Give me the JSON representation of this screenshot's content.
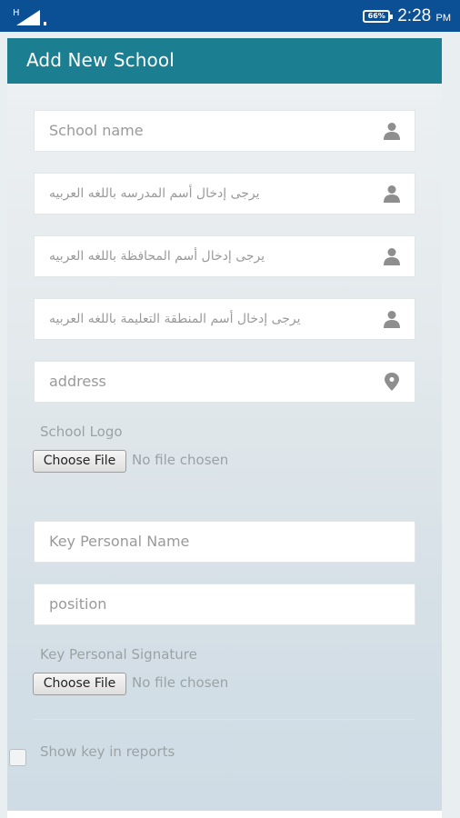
{
  "status_bar": {
    "network_type": "H",
    "battery_percent": "66%",
    "time": "2:28",
    "ampm": "PM"
  },
  "form": {
    "title": "Add New School",
    "fields": [
      {
        "placeholder": "School name",
        "icon": "person-icon"
      },
      {
        "placeholder": "يرجى إدخال أسم المدرسه باللغه العربيه",
        "icon": "person-icon"
      },
      {
        "placeholder": "يرجى إدخال أسم المحافظة باللغه العربيه",
        "icon": "person-icon"
      },
      {
        "placeholder": "يرجى إدخال أسم المنطقة التعليمة باللغه العربيه",
        "icon": "person-icon"
      },
      {
        "placeholder": "address",
        "icon": "map-pin-icon"
      }
    ],
    "school_logo": {
      "label": "School Logo",
      "button": "Choose File",
      "status": "No file chosen"
    },
    "key_personal_name": {
      "placeholder": "Key Personal Name"
    },
    "position": {
      "placeholder": "position"
    },
    "signature": {
      "label": "Key Personal Signature",
      "button": "Choose File",
      "status": "No file chosen"
    },
    "show_key": {
      "label": "Show key in reports",
      "checked": false
    }
  },
  "colors": {
    "status_bar": "#0b4f95",
    "header": "#1b7f91",
    "background": "#e9eef1"
  }
}
